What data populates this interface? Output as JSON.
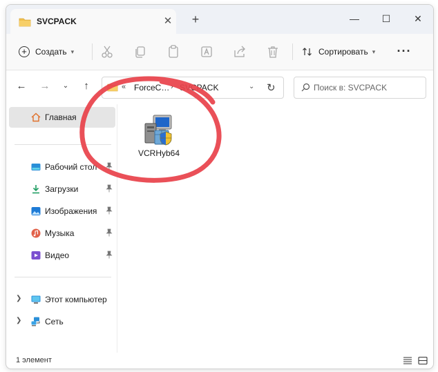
{
  "window": {
    "tab_title": "SVCPACK",
    "tab_close": "✕",
    "new_tab": "+",
    "minimize": "—",
    "maximize": "☐",
    "close": "✕"
  },
  "toolbar": {
    "create_label": "Создать",
    "sort_label": "Сортировать",
    "more": "···"
  },
  "address": {
    "overflow": "«",
    "crumbs": [
      "ForceC…",
      "SVCPACK"
    ],
    "separator": "›"
  },
  "search": {
    "placeholder": "Поиск в: SVCPACK"
  },
  "sidebar": {
    "home": "Главная",
    "pinned": [
      {
        "label": "Рабочий стол",
        "icon": "desktop-icon"
      },
      {
        "label": "Загрузки",
        "icon": "download-icon"
      },
      {
        "label": "Изображения",
        "icon": "pictures-icon"
      },
      {
        "label": "Музыка",
        "icon": "music-icon"
      },
      {
        "label": "Видео",
        "icon": "video-icon"
      }
    ],
    "devices": [
      {
        "label": "Этот компьютер",
        "icon": "computer-icon"
      },
      {
        "label": "Сеть",
        "icon": "network-icon"
      }
    ]
  },
  "files": [
    {
      "name": "VCRHyb64",
      "icon": "installer-icon"
    }
  ],
  "status": {
    "count": "1 элемент"
  },
  "colors": {
    "accent": "#0067c0",
    "folder": "#f2c14e",
    "annotation": "#e8434b",
    "selection": "#e5e5e5"
  }
}
